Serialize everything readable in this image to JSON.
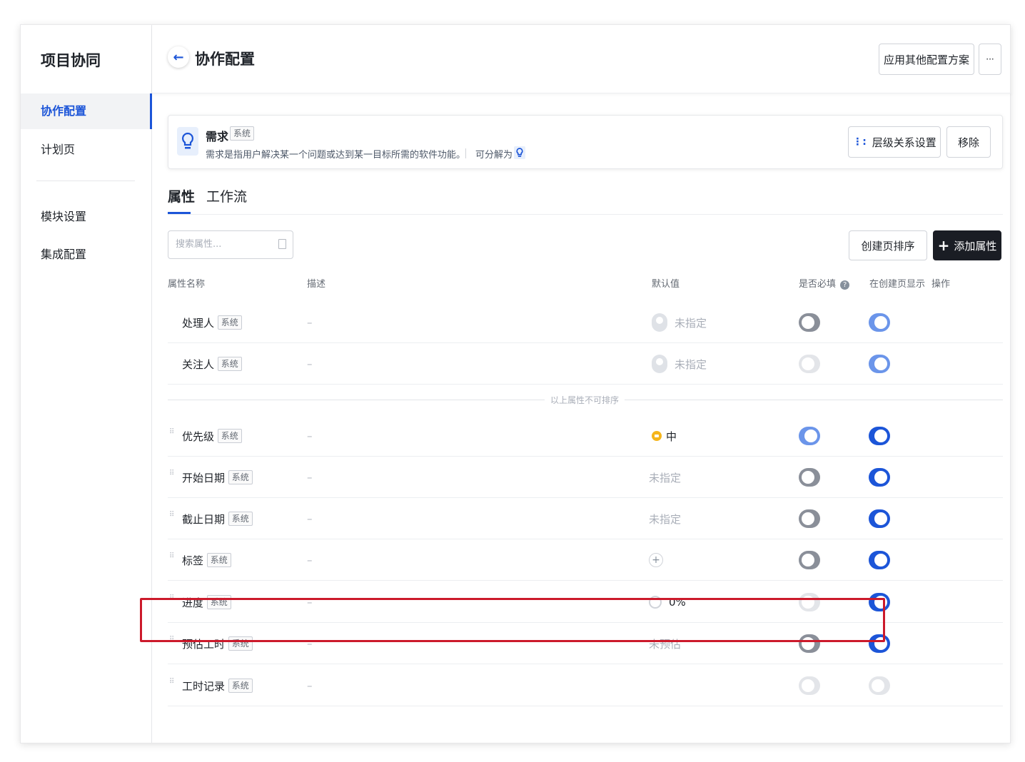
{
  "sidebar": {
    "title": "项目协同",
    "items": [
      {
        "label": "协作配置",
        "active": true
      },
      {
        "label": "计划页",
        "active": false
      },
      {
        "label": "模块设置",
        "active": false
      },
      {
        "label": "集成配置",
        "active": false
      }
    ]
  },
  "header": {
    "title": "协作配置",
    "apply_scheme_label": "应用其他配置方案",
    "more_label": "···"
  },
  "card": {
    "name": "需求",
    "tag": "系统",
    "description": "需求是指用户解决某一个问题或达到某一目标所需的软件功能。",
    "split_label": "可分解为",
    "hierarchy_label": "层级关系设置",
    "remove_label": "移除"
  },
  "tabs": [
    {
      "label": "属性",
      "active": true
    },
    {
      "label": "工作流",
      "active": false
    }
  ],
  "toolbar": {
    "search_placeholder": "搜索属性...",
    "sort_label": "创建页排序",
    "add_label": "添加属性"
  },
  "table": {
    "headers": {
      "name": "属性名称",
      "desc": "描述",
      "default": "默认值",
      "required": "是否必填",
      "show_on_create": "在创建页显示",
      "action": "操作"
    },
    "separator": "以上属性不可排序",
    "rows": [
      {
        "name": "处理人",
        "tag": "系统",
        "desc": "–",
        "default": "未指定",
        "required": false,
        "show": true
      },
      {
        "name": "关注人",
        "tag": "系统",
        "desc": "–",
        "default": "未指定",
        "required": false,
        "show": true
      },
      {
        "name": "优先级",
        "tag": "系统",
        "desc": "–",
        "default": "中",
        "required": true,
        "show": true
      },
      {
        "name": "开始日期",
        "tag": "系统",
        "desc": "–",
        "default": "未指定",
        "required": false,
        "show": true
      },
      {
        "name": "截止日期",
        "tag": "系统",
        "desc": "–",
        "default": "未指定",
        "required": false,
        "show": true
      },
      {
        "name": "标签",
        "tag": "系统",
        "desc": "–",
        "default": "+",
        "required": false,
        "show": true
      },
      {
        "name": "进度",
        "tag": "系统",
        "desc": "–",
        "default": "0%",
        "required": false,
        "show": true
      },
      {
        "name": "预估工时",
        "tag": "系统",
        "desc": "–",
        "default": "未预估",
        "required": false,
        "show": true
      },
      {
        "name": "工时记录",
        "tag": "系统",
        "desc": "–",
        "default": "",
        "required": false,
        "show": false
      }
    ]
  },
  "colors": {
    "primary": "#1c55d8",
    "highlight": "#cc1a2b",
    "priority_medium": "#f5b51b"
  }
}
